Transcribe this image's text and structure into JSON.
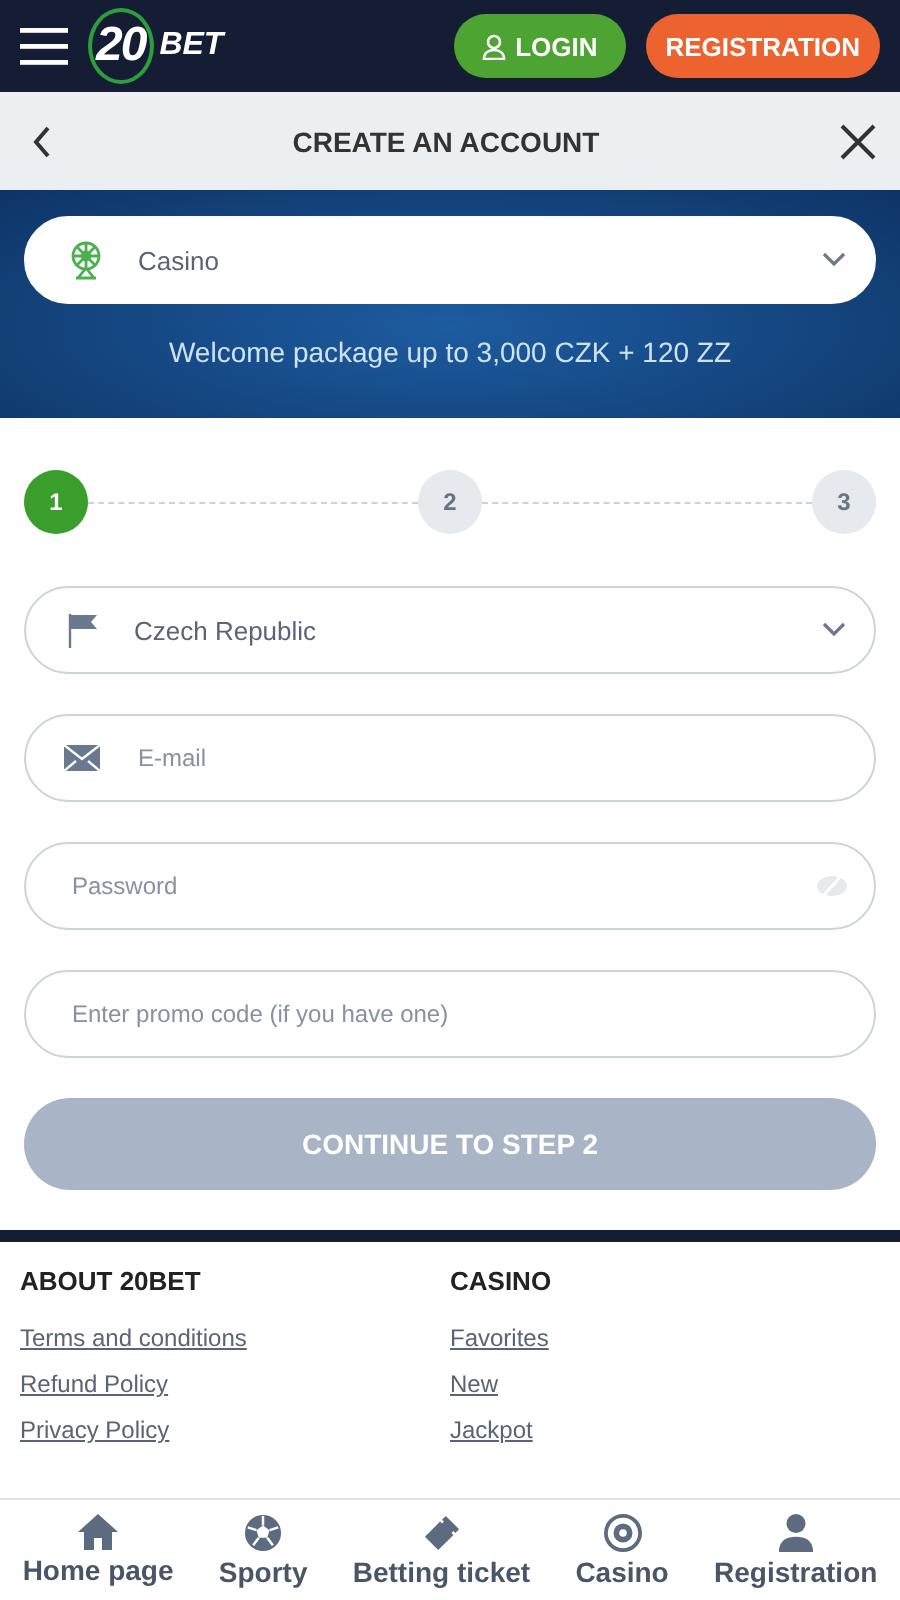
{
  "header": {
    "logo": {
      "number": "20",
      "word": "BET"
    },
    "login": "LOGIN",
    "register": "REGISTRATION"
  },
  "title_bar": {
    "title": "CREATE AN ACCOUNT"
  },
  "banner": {
    "product": "Casino",
    "text": "Welcome package up to 3,000 CZK + 120 ZZ"
  },
  "steps": [
    {
      "label": "1",
      "selected": true
    },
    {
      "label": "2",
      "selected": false
    },
    {
      "label": "3",
      "selected": false
    }
  ],
  "fields": [
    {
      "kind": "country",
      "value": "Czech Republic"
    },
    {
      "kind": "email",
      "placeholder": "E-mail"
    },
    {
      "kind": "password",
      "placeholder": "Password"
    },
    {
      "kind": "promo",
      "placeholder": "Enter promo code (if you have one)"
    }
  ],
  "continue_button": {
    "label": "CONTINUE TO STEP 2",
    "disabled": true
  },
  "footer": {
    "columns": [
      {
        "heading": "ABOUT 20BET",
        "links": [
          "Terms and conditions",
          "Refund Policy",
          "Privacy Policy"
        ]
      },
      {
        "heading": "CASINO",
        "links": [
          "Favorites",
          "New",
          "Jackpot"
        ]
      }
    ]
  },
  "bottom_nav": [
    {
      "kind": "home",
      "label": "Home page"
    },
    {
      "kind": "ball",
      "label": "Sporty"
    },
    {
      "kind": "ticket",
      "label": "Betting ticket"
    },
    {
      "kind": "chip",
      "label": "Casino"
    },
    {
      "kind": "person",
      "label": "Registration"
    }
  ]
}
